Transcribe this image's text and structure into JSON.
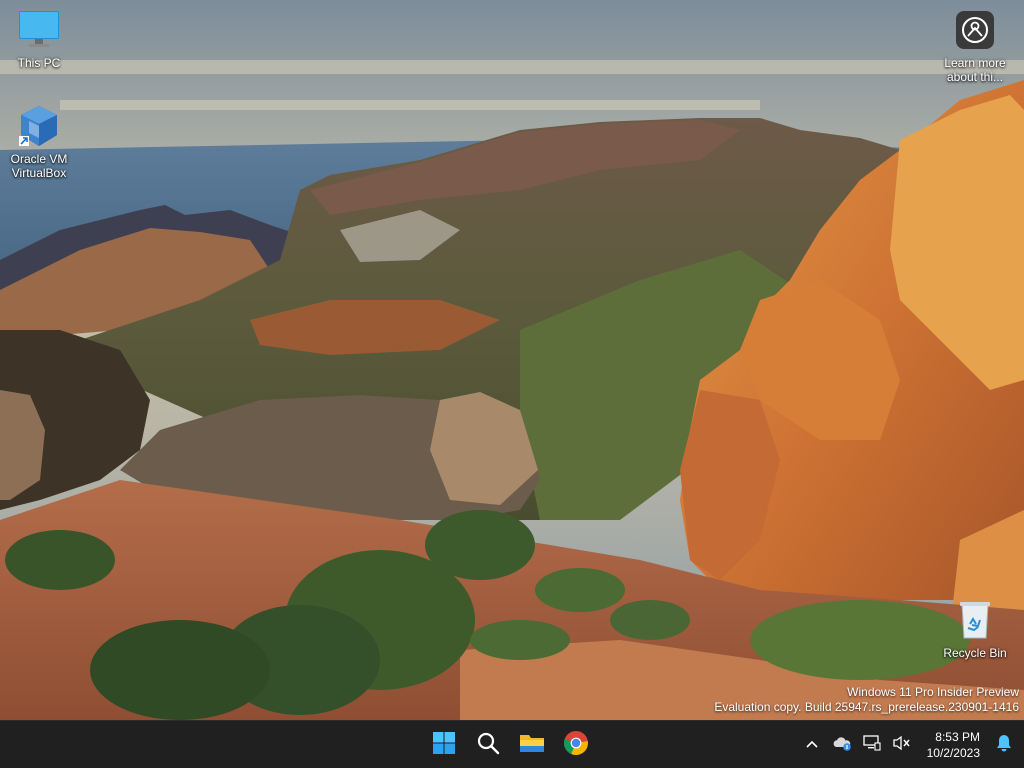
{
  "desktop": {
    "icons": [
      {
        "label": "This PC",
        "icon": "monitor-icon"
      },
      {
        "label": "Oracle VM VirtualBox",
        "icon": "virtualbox-icon"
      },
      {
        "label": "Learn more about thi...",
        "icon": "learn-more-icon"
      },
      {
        "label": "Recycle Bin",
        "icon": "recycle-bin-icon"
      }
    ],
    "watermark": {
      "line1": "Windows 11 Pro Insider Preview",
      "line2": "Evaluation copy. Build 25947.rs_prerelease.230901-1416"
    }
  },
  "taskbar": {
    "apps": [
      {
        "name": "Start",
        "icon": "windows-start-icon"
      },
      {
        "name": "Search",
        "icon": "search-icon"
      },
      {
        "name": "File Explorer",
        "icon": "folder-icon"
      },
      {
        "name": "Google Chrome",
        "icon": "chrome-icon"
      }
    ],
    "tray": {
      "icons": [
        "chevron-up-icon",
        "onedrive-icon",
        "network-icon",
        "volume-muted-icon"
      ],
      "time": "8:53 PM",
      "date": "10/2/2023",
      "notification_icon": "bell-icon"
    },
    "colors": {
      "background": "#202020",
      "accent": "#0078d4"
    }
  }
}
